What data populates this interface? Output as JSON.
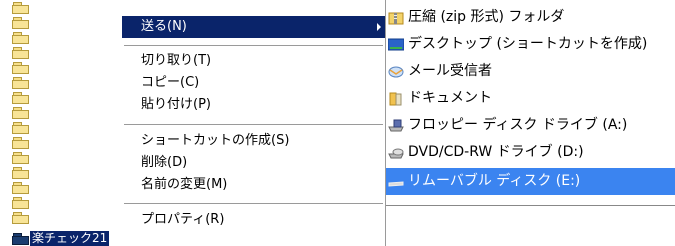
{
  "file_list": {
    "selected_folder_label": "楽チェック21"
  },
  "context_menu": {
    "send_to": "送る(N)",
    "cut": "切り取り(T)",
    "copy": "コピー(C)",
    "paste": "貼り付け(P)",
    "create_shortcut": "ショートカットの作成(S)",
    "delete": "削除(D)",
    "rename": "名前の変更(M)",
    "properties": "プロパティ(R)"
  },
  "send_to_submenu": {
    "items": [
      {
        "label": "圧縮 (zip 形式) フォルダ",
        "icon": "zip-folder-icon"
      },
      {
        "label": "デスクトップ (ショートカットを作成)",
        "icon": "desktop-icon"
      },
      {
        "label": "メール受信者",
        "icon": "mail-recipient-icon"
      },
      {
        "label": "ドキュメント",
        "icon": "documents-icon"
      },
      {
        "label": "フロッピー ディスク ドライブ (A:)",
        "icon": "floppy-drive-icon"
      },
      {
        "label": "DVD/CD-RW ドライブ (D:)",
        "icon": "dvd-drive-icon"
      },
      {
        "label": "リムーバブル ディスク (E:)",
        "icon": "removable-disk-icon"
      }
    ]
  },
  "colors": {
    "menu_highlight": "#0a246a",
    "submenu_highlight": "#3b84f0"
  }
}
